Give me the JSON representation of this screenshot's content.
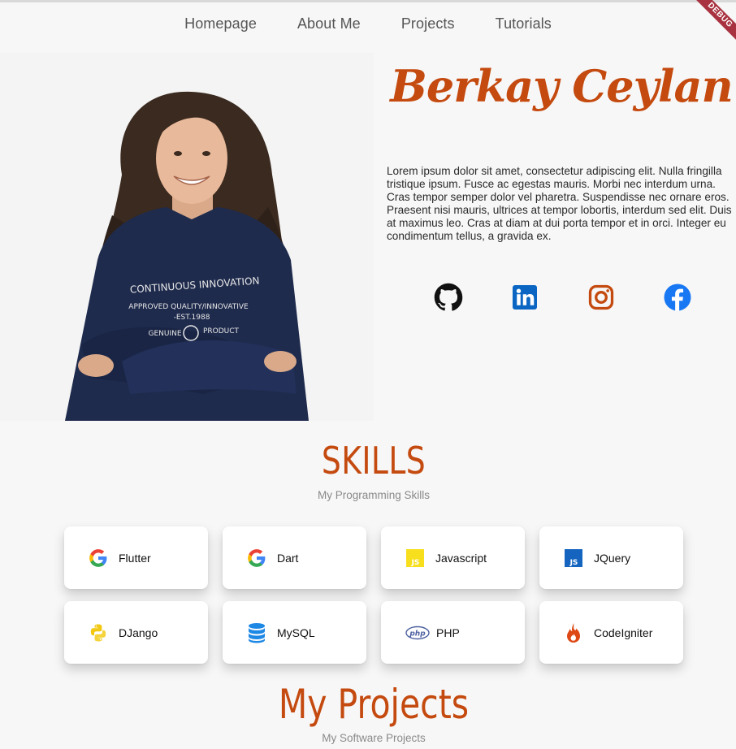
{
  "nav": {
    "items": [
      {
        "label": "Homepage"
      },
      {
        "label": "About Me"
      },
      {
        "label": "Projects"
      },
      {
        "label": "Tutorials"
      }
    ]
  },
  "debug_banner": "DEBUG",
  "profile": {
    "name": "Berkay Ceylan",
    "bio": "Lorem ipsum dolor sit amet, consectetur adipiscing elit. Nulla fringilla tristique ipsum. Fusce ac egestas mauris. Morbi nec interdum urna. Cras tempor semper dolor vel pharetra. Suspendisse nec ornare eros. Praesent nisi mauris, ultrices at tempor lobortis, interdum sed elit. Duis at maximus leo. Cras at diam at dui porta tempor et in orci. Integer eu condimentum tellus, a gravida ex.",
    "shirt_text": [
      "CONTINUOUS INNOVATION",
      "APPROVED QUALITY/INNOVATIVE",
      "-EST.1988",
      "GENUINE",
      "PRODUCT"
    ],
    "socials": [
      {
        "icon": "github-icon",
        "color": "#111111"
      },
      {
        "icon": "linkedin-icon",
        "color": "#0a66c2"
      },
      {
        "icon": "instagram-icon",
        "color": "#c44a0f"
      },
      {
        "icon": "facebook-icon",
        "color": "#1877f2"
      }
    ]
  },
  "skills": {
    "title": "SKILLS",
    "subtitle": "My Programming Skills",
    "items": [
      {
        "label": "Flutter",
        "icon": "google-icon"
      },
      {
        "label": "Dart",
        "icon": "google-icon"
      },
      {
        "label": "Javascript",
        "icon": "javascript-icon"
      },
      {
        "label": "JQuery",
        "icon": "js-square-icon"
      },
      {
        "label": "DJango",
        "icon": "python-icon"
      },
      {
        "label": "MySQL",
        "icon": "database-icon"
      },
      {
        "label": "PHP",
        "icon": "php-icon"
      },
      {
        "label": "CodeIgniter",
        "icon": "codeigniter-flame-icon"
      }
    ]
  },
  "projects": {
    "title": "My Projects",
    "subtitle": "My Software Projects"
  },
  "colors": {
    "accent": "#c44a0f",
    "background": "#f7f7f7",
    "card": "#ffffff"
  }
}
